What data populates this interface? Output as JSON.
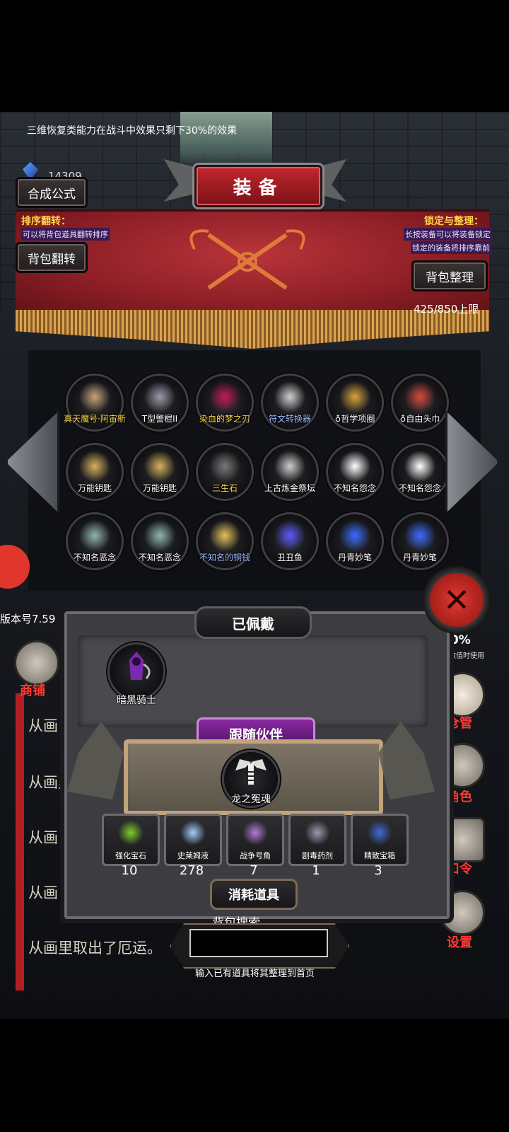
{
  "hint_text": "三维恢复类能力在战斗中效果只剩下30%的效果",
  "gems": {
    "count": "14309",
    "icon": "blue-crystal-icon"
  },
  "title": "装备",
  "buttons": {
    "synthesis": "合成公式",
    "flip_bag": "背包翻转",
    "sort_bag": "背包整理"
  },
  "tips": {
    "sort_flip_head": "排序翻转：",
    "sort_flip_body": "可以将背包道具翻转排序",
    "lock_head": "锁定与整理：",
    "lock_body_1": "长按装备可以将装备锁定",
    "lock_body_2": "锁定的装备将排序靠前"
  },
  "capacity": "425/850上限",
  "items": [
    {
      "label": "真天魔号·阿宙斯",
      "icon": "armored-demon-icon",
      "color": "#ffd54a"
    },
    {
      "label": "T型警棍II",
      "icon": "baton-icon",
      "color": "#ffffff"
    },
    {
      "label": "染血的梦之刃",
      "icon": "blood-blade-icon",
      "color": "#ffd54a"
    },
    {
      "label": "符文转换器",
      "icon": "rune-converter-icon",
      "color": "#9db9ff"
    },
    {
      "label": "♁哲学项圈",
      "icon": "golden-collar-icon",
      "color": "#ffffff"
    },
    {
      "label": "♁自由头巾",
      "icon": "red-bandana-icon",
      "color": "#ffffff"
    },
    {
      "label": "万能钥匙",
      "icon": "key-icon",
      "color": "#ffffff"
    },
    {
      "label": "万能钥匙",
      "icon": "key-icon",
      "color": "#ffffff"
    },
    {
      "label": "三生石",
      "icon": "stone-icon",
      "color": "#ffd54a"
    },
    {
      "label": "上古炼金祭坛",
      "icon": "skull-altar-icon",
      "color": "#ffffff"
    },
    {
      "label": "不知名怨念",
      "icon": "ghost-icon",
      "color": "#ffffff"
    },
    {
      "label": "不知名怨念",
      "icon": "ghost-icon",
      "color": "#ffffff"
    },
    {
      "label": "不知名恶念",
      "icon": "wraith-icon",
      "color": "#ffffff"
    },
    {
      "label": "不知名恶念",
      "icon": "wraith-icon",
      "color": "#ffffff"
    },
    {
      "label": "不知名的铜钱",
      "icon": "coin-icon",
      "color": "#9db9ff"
    },
    {
      "label": "丑丑鱼",
      "icon": "fish-icon",
      "color": "#ffffff"
    },
    {
      "label": "丹青妙笔",
      "icon": "brush-icon",
      "color": "#ffffff"
    },
    {
      "label": "丹青妙笔",
      "icon": "brush-icon",
      "color": "#ffffff"
    }
  ],
  "version": "版本号7.59",
  "equipped": {
    "title": "已佩戴",
    "item": {
      "label": "暗黑骑士",
      "icon": "dark-knight-icon"
    }
  },
  "companion": {
    "title": "跟随伙伴",
    "item": {
      "label": "龙之冤魂",
      "icon": "dragon-skeleton-icon"
    }
  },
  "consumables": {
    "title": "消耗道具",
    "items": [
      {
        "label": "强化宝石",
        "count": "10",
        "icon": "green-gem-icon"
      },
      {
        "label": "史莱姆液",
        "count": "278",
        "icon": "slime-bottle-icon"
      },
      {
        "label": "战争号角",
        "count": "7",
        "icon": "war-horn-icon"
      },
      {
        "label": "剧毒药剂",
        "count": "1",
        "icon": "poison-flask-icon"
      },
      {
        "label": "精致宝箱",
        "count": "3",
        "icon": "chest-icon"
      }
    ]
  },
  "search": {
    "label": "背包搜索",
    "value": "",
    "hint": "输入已有道具将其整理到首页"
  },
  "side_menu": {
    "shop": "商铺",
    "manage": "仓管",
    "character": "角色",
    "password": "口令",
    "settings": "设置",
    "partial_number": "50%",
    "partial_caption": "其数值时使用"
  },
  "log_lines": [
    "从画",
    "从画里",
    "从画",
    "从画",
    "从画里取出了厄运。"
  ],
  "colors": {
    "accent_red": "#b8343a",
    "gold_text": "#ffd54a",
    "blue_text": "#9db9ff"
  }
}
